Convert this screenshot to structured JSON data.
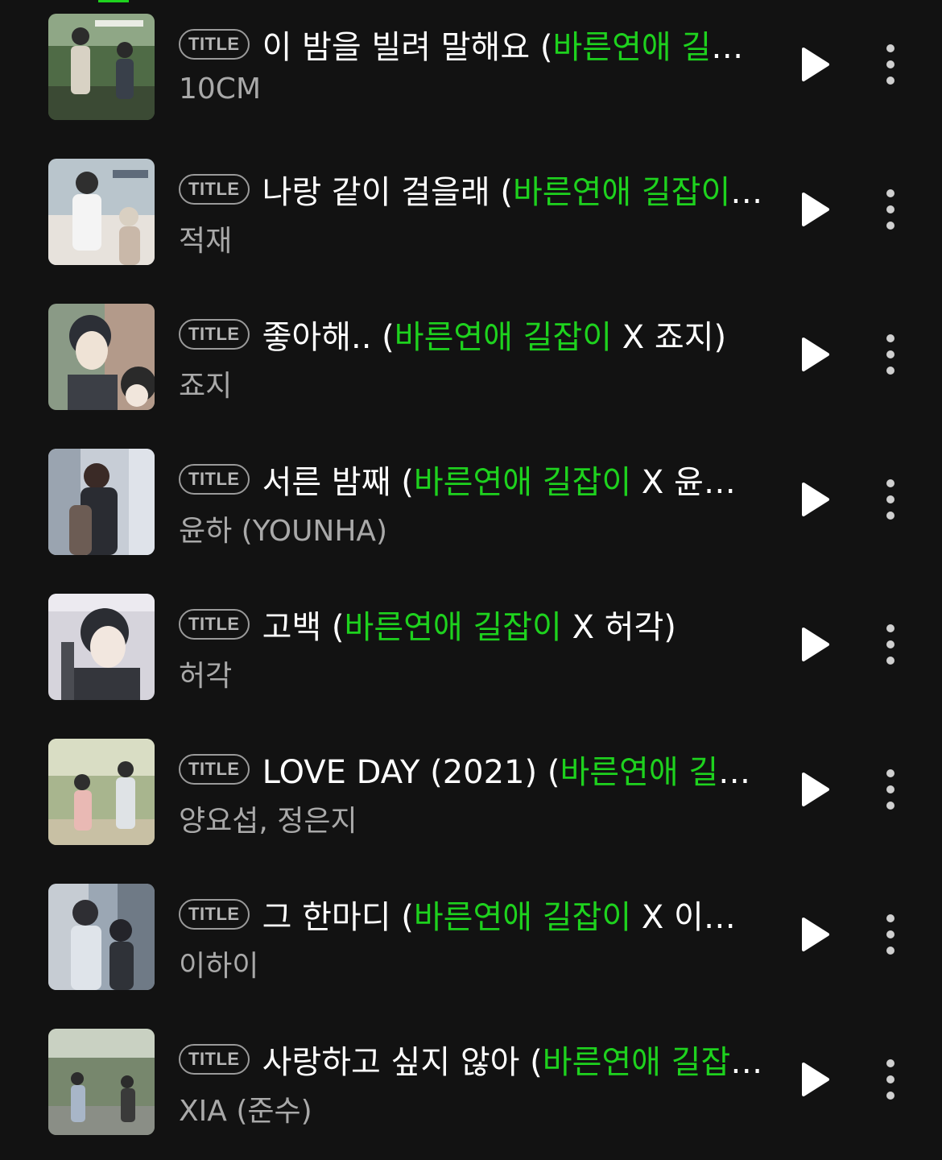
{
  "colors": {
    "background": "#121212",
    "accent_green": "#1ed21e",
    "primary_text": "#ffffff",
    "secondary_text": "#a9a9a9",
    "badge_border": "#9a9a9a"
  },
  "badge_label": "TITLE",
  "icons": {
    "play": "play-icon",
    "more": "more-vertical-icon"
  },
  "tracks": [
    {
      "title_pre": "이 밤을 빌려 말해요 (",
      "title_green": "바른연애 길",
      "title_post": "…",
      "artist": "10CM"
    },
    {
      "title_pre": "나랑 같이 걸을래 (",
      "title_green": "바른연애 길잡이",
      "title_post": "…",
      "artist": "적재"
    },
    {
      "title_pre": "좋아해.. (",
      "title_green": "바른연애 길잡이",
      "title_post": " X 죠지)",
      "artist": "죠지"
    },
    {
      "title_pre": "서른 밤째 (",
      "title_green": "바른연애 길잡이",
      "title_post": " X 윤…",
      "artist": "윤하 (YOUNHA)"
    },
    {
      "title_pre": "고백 (",
      "title_green": "바른연애 길잡이",
      "title_post": " X 허각)",
      "artist": "허각"
    },
    {
      "title_pre": "LOVE DAY (2021) (",
      "title_green": "바른연애 길",
      "title_post": "…",
      "artist": "양요섭, 정은지"
    },
    {
      "title_pre": "그 한마디 (",
      "title_green": "바른연애 길잡이",
      "title_post": " X 이…",
      "artist": "이하이"
    },
    {
      "title_pre": "사랑하고 싶지 않아 (",
      "title_green": "바른연애 길잡",
      "title_post": "…",
      "artist": "XIA (준수)"
    }
  ]
}
